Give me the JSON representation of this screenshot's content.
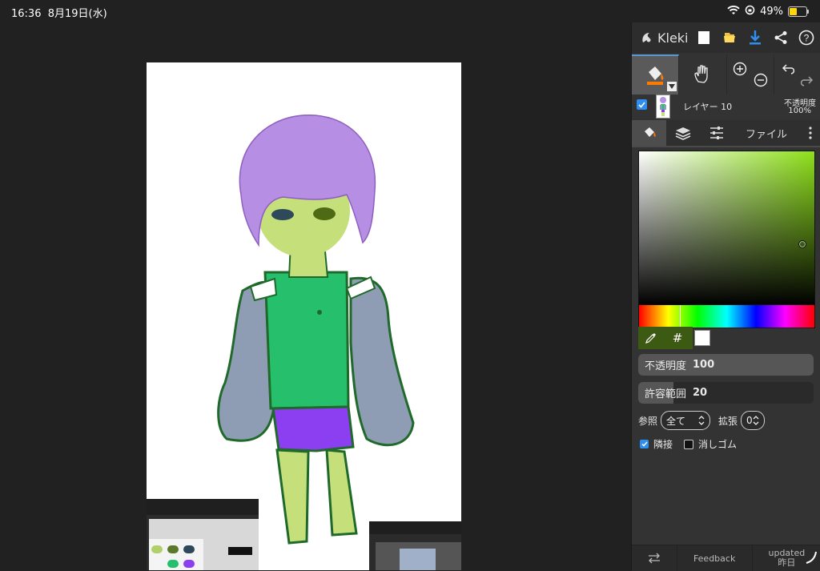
{
  "status": {
    "time": "16:36",
    "date": "8月19日(水)",
    "battery": "49%",
    "battery_level": 0.49
  },
  "app": {
    "name": "Kleki"
  },
  "layer": {
    "name": "レイヤー 10",
    "opacity_label": "不透明度",
    "opacity_value": "100%"
  },
  "tabs": {
    "file": "ファイル"
  },
  "fill_tool": {
    "hex_symbol": "#",
    "opacity_label": "不透明度",
    "opacity_value": "100",
    "opacity_level": 1.0,
    "tolerance_label": "許容範囲",
    "tolerance_value": "20",
    "tolerance_level": 0.2,
    "sample_label": "参照",
    "sample_value": "全て",
    "grow_label": "拡張",
    "grow_value": "0",
    "contiguous_label": "隣接",
    "eraser_label": "消しゴム"
  },
  "bottom": {
    "feedback": "Feedback",
    "updated": "updated",
    "updated_when": "昨日"
  },
  "colors": {
    "accent": "#5b9bd5",
    "picked_green": "#8ee01a",
    "swatch_dark": "#3d5a12",
    "secondary": "#ffffff"
  }
}
